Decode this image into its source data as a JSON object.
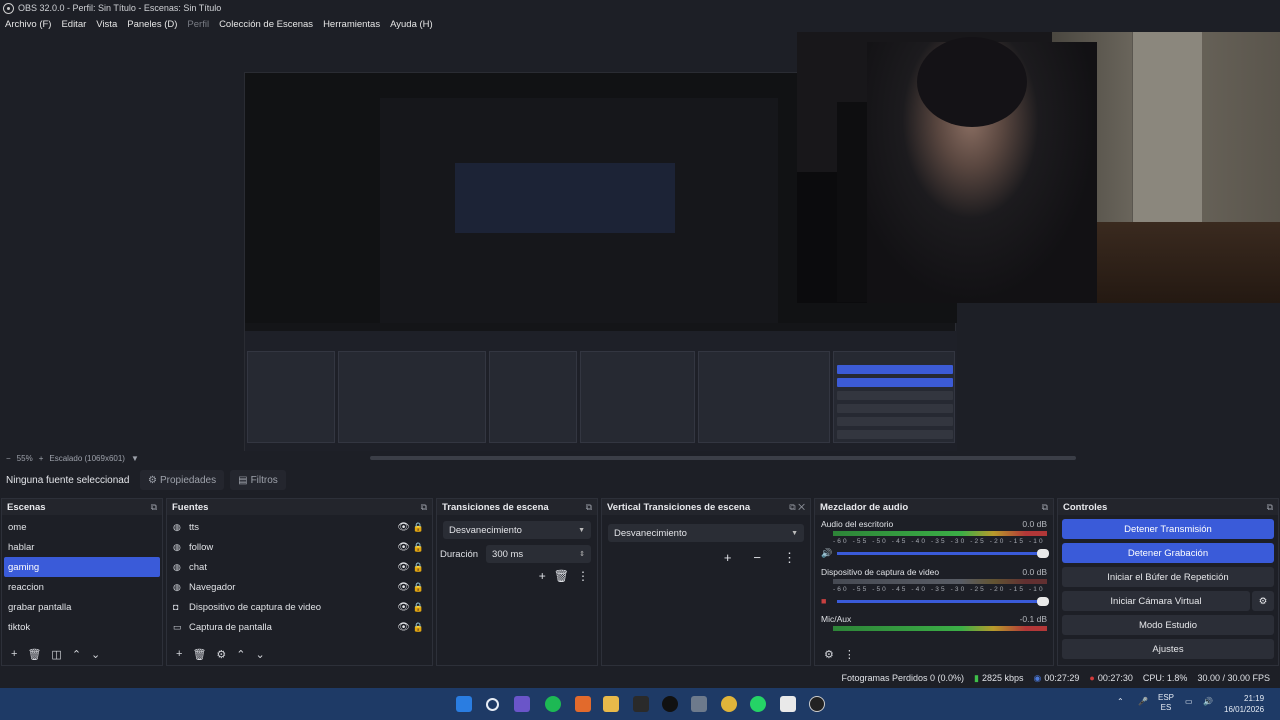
{
  "window": {
    "title": "OBS 32.0.0 - Perfil: Sin Título - Escenas: Sin Título"
  },
  "menu": {
    "items": [
      {
        "label": "Archivo (F)",
        "enabled": true
      },
      {
        "label": "Editar",
        "enabled": true
      },
      {
        "label": "Vista",
        "enabled": true
      },
      {
        "label": "Paneles (D)",
        "enabled": true
      },
      {
        "label": "Perfil",
        "enabled": false
      },
      {
        "label": "Colección de Escenas",
        "enabled": true
      },
      {
        "label": "Herramientas",
        "enabled": true
      },
      {
        "label": "Ayuda (H)",
        "enabled": true
      }
    ]
  },
  "preview": {
    "zoom": "55%",
    "scale": "Escalado (1069x601)"
  },
  "source_bar": {
    "no_source": "Ninguna fuente seleccionad",
    "properties": "Propiedades",
    "filters": "Filtros"
  },
  "scenes": {
    "title": "Escenas",
    "items": [
      "ome",
      "hablar",
      "gaming",
      "reaccion",
      "grabar pantalla",
      "tiktok"
    ],
    "selected": "gaming"
  },
  "sources": {
    "title": "Fuentes",
    "items": [
      {
        "name": "tts",
        "icon": "browser-icon"
      },
      {
        "name": "follow",
        "icon": "browser-icon"
      },
      {
        "name": "chat",
        "icon": "browser-icon"
      },
      {
        "name": "Navegador",
        "icon": "browser-icon"
      },
      {
        "name": "Dispositivo de captura de video",
        "icon": "camera-icon"
      },
      {
        "name": "Captura de pantalla",
        "icon": "monitor-icon"
      }
    ]
  },
  "transitions": {
    "title": "Transiciones de escena",
    "selected": "Desvanecimiento",
    "duration_label": "Duración",
    "duration_value": "300 ms"
  },
  "vertical_transitions": {
    "title": "Vertical Transiciones de escena",
    "selected": "Desvanecimiento"
  },
  "audio_mixer": {
    "title": "Mezclador de audio",
    "channels": [
      {
        "name": "Audio del escritorio",
        "db": "0.0 dB",
        "level": 0.87,
        "muted": false
      },
      {
        "name": "Dispositivo de captura de video",
        "db": "0.0 dB",
        "level": 0.6,
        "muted": true
      },
      {
        "name": "Mic/Aux",
        "db": "-0.1 dB",
        "level": 0.9,
        "muted": false
      }
    ],
    "scale": "-60 -55 -50 -45 -40 -35 -30 -25 -20 -15 -10 -5 0"
  },
  "controls": {
    "title": "Controles",
    "buttons": [
      {
        "label": "Detener Transmisión",
        "active": true
      },
      {
        "label": "Detener Grabación",
        "active": true
      },
      {
        "label": "Iniciar el Búfer de Repetición",
        "active": false
      },
      {
        "label": "Iniciar Cámara Virtual",
        "active": false
      },
      {
        "label": "Modo Estudio",
        "active": false
      },
      {
        "label": "Ajustes",
        "active": false
      }
    ]
  },
  "status": {
    "dropped_frames": "Fotogramas Perdidos 0 (0.0%)",
    "bitrate": "2825 kbps",
    "stream_time": "00:27:29",
    "rec_time": "00:27:30",
    "cpu": "CPU: 1.8%",
    "fps": "30.00 / 30.00 FPS"
  },
  "tray": {
    "lang": "ESP",
    "lang2": "ES",
    "time": "21:19",
    "date": "16/01/2026"
  },
  "colors": {
    "accent": "#3a5bd9",
    "bg": "#1d1f26",
    "taskbar": "#1e3a66"
  }
}
